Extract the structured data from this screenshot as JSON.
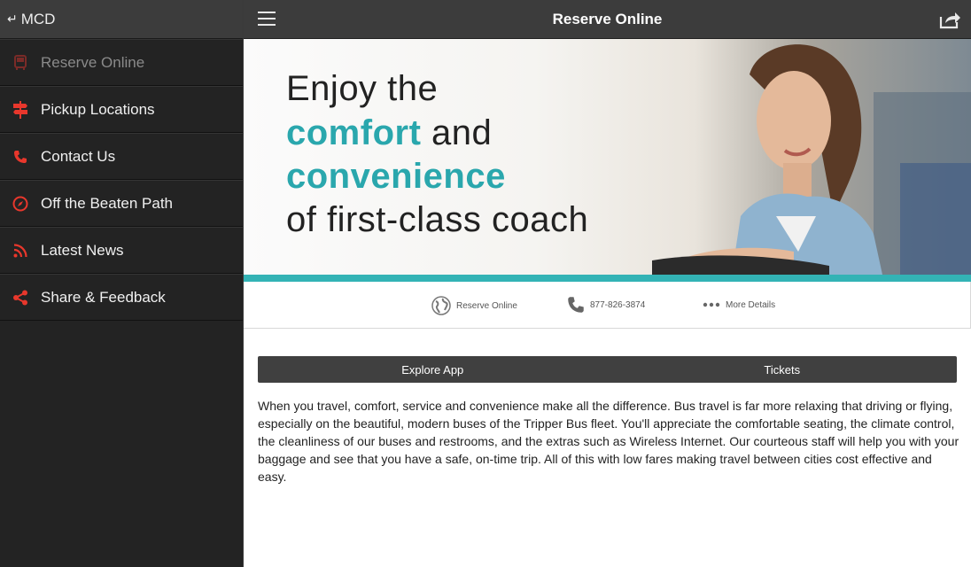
{
  "sidebar": {
    "header": {
      "back_label": "MCD"
    },
    "items": [
      {
        "label": "Reserve Online",
        "icon": "bus-icon",
        "active": true
      },
      {
        "label": "Pickup Locations",
        "icon": "signpost-icon",
        "active": false
      },
      {
        "label": "Contact Us",
        "icon": "phone-icon",
        "active": false
      },
      {
        "label": "Off the Beaten Path",
        "icon": "compass-icon",
        "active": false
      },
      {
        "label": "Latest News",
        "icon": "rss-icon",
        "active": false
      },
      {
        "label": "Share & Feedback",
        "icon": "share-icon",
        "active": false
      }
    ]
  },
  "topbar": {
    "title": "Reserve Online"
  },
  "banner": {
    "line1": "Enjoy the",
    "line2_accent": "comfort",
    "line2_rest": " and",
    "line3_accent": "convenience",
    "line4": "of first-class coach"
  },
  "infobar": {
    "reserve": "Reserve Online",
    "phone": "877-826-3874",
    "more": "More Details"
  },
  "tabs": [
    {
      "label": "Explore App"
    },
    {
      "label": "Tickets"
    }
  ],
  "body_text": "When you travel, comfort, service and convenience make all the difference. Bus travel is far more relaxing that driving or flying, especially on the beautiful, modern buses of the Tripper Bus fleet. You'll appreciate the comfortable seating, the climate control, the cleanliness of our buses and restrooms, and the extras such as Wireless Internet. Our courteous staff will help you with your baggage and see that you have a safe, on-time trip. All of this with low fares making travel between cities cost effective and easy.",
  "colors": {
    "accent_red": "#e8372c",
    "teal": "#33b3b5",
    "sidebar_bg": "#232323",
    "topbar_bg": "#3c3c3c"
  }
}
